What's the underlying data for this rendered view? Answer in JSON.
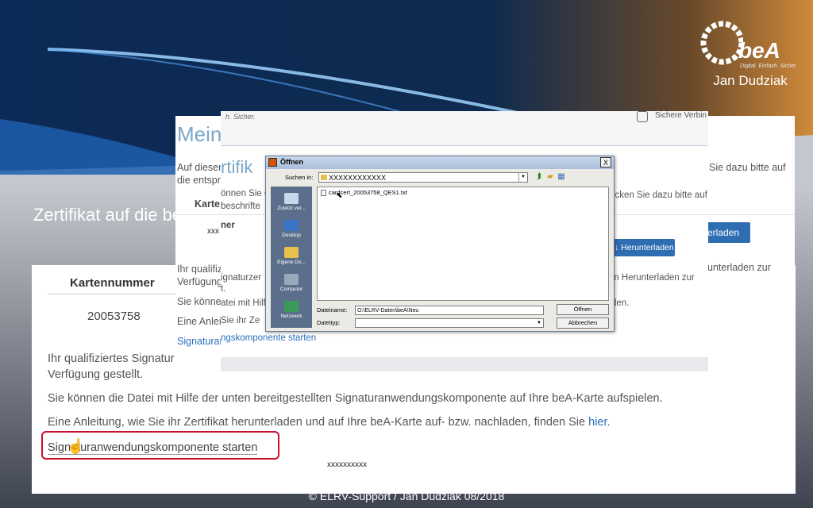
{
  "slide": {
    "title": "Zertifikat auf die beA-Karte laden",
    "brand_logo": "beA",
    "brand_tagline": "Digital. Einfach. Sicher.",
    "author": "Jan Dudziak",
    "footer": "© ELRV-Support / Jan Dudziak 08/2018"
  },
  "large_screenshot": {
    "column_header": "Kartennummer",
    "card_number": "20053758",
    "paragraph1_line1": "Ihr qualifiziertes Signatur",
    "paragraph1_line2": "Verfügung gestellt.",
    "paragraph2": "Sie können die Datei mit Hilfe der unten bereitgestellten Signaturanwendungskomponente auf Ihre beA-Karte aufspielen.",
    "paragraph3_text": "Eine Anleitung, wie Sie ihr Zertifikat herunterladen und auf Ihre beA-Karte auf- bzw. nachladen, finden Sie",
    "paragraph3_link": "hier.",
    "launch_link": "Signaturanwendungskomponente starten",
    "masked_text": "xxxxxxxxxx"
  },
  "middle_screenshot": {
    "heading": "Mein",
    "line1": "Auf dieser",
    "line2": "die entspr",
    "label_karte": "Karte",
    "masked": "xxx",
    "line_ihr": "Ihr qualifiz",
    "line_verf": "Verfügung",
    "line_sie": "Sie könner",
    "line_eine": "Eine Anleit",
    "link_sig": "Signaturar",
    "right1": "Sie dazu bitte auf",
    "right_btn": "nterladen",
    "right2": "unterladen zur"
  },
  "front_screenshot": {
    "top_small": "h. Sicher.",
    "secure_label": "Sichere Verbin",
    "heading": "rtifik",
    "line1": "önnen Sie c",
    "line2": "beschrifte",
    "line3": "ner",
    "line4": "ignaturzer",
    "line5": "t.",
    "line6": "atei mit Hilf",
    "line7": "Sie ihr Ze",
    "link": "ngskomponente starten",
    "right1": "icken Sie dazu bitte auf",
    "download_button": "Herunterladen",
    "right2": "m Herunterladen zur",
    "right3": "den."
  },
  "open_dialog": {
    "title": "Öffnen",
    "look_in_label": "Suchen in:",
    "look_in_value": "XXXXXXXXXXXX",
    "places": [
      "Zuletzt ver...",
      "Desktop",
      "Eigene Do...",
      "Computer",
      "Netzwerk"
    ],
    "file_item": "cardcert_20053758_QES1.txt",
    "filename_label": "Dateiname:",
    "filename_value": "O:\\ELRV-Daten\\beA\\Neu",
    "filetype_label": "Dateityp:",
    "filetype_value": "",
    "open_button": "Öffnen",
    "cancel_button": "Abbrechen",
    "close_button": "X"
  },
  "colors": {
    "accent_red": "#c8102e",
    "link_blue": "#2a6fbd",
    "button_blue": "#2f6db3"
  }
}
